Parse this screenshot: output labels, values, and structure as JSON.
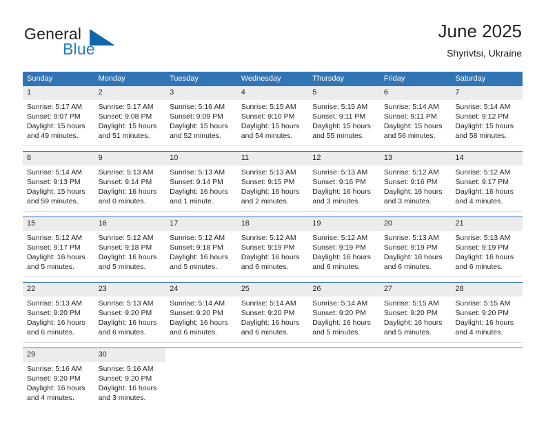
{
  "brand": {
    "name_part1": "General",
    "name_part2": "Blue",
    "logo_icon": "blue-triangle-flag-icon"
  },
  "header": {
    "title": "June 2025",
    "location": "Shyrivtsi, Ukraine"
  },
  "colors": {
    "header_blue": "#3275b5",
    "brand_blue": "#1f7fc4",
    "daynum_gray": "#ececec",
    "text": "#231f20",
    "separator": "#d9d9d9"
  },
  "weekday_headers": [
    "Sunday",
    "Monday",
    "Tuesday",
    "Wednesday",
    "Thursday",
    "Friday",
    "Saturday"
  ],
  "weeks": [
    {
      "days": [
        {
          "date": "1",
          "sunrise": "Sunrise: 5:17 AM",
          "sunset": "Sunset: 9:07 PM",
          "daylight_line1": "Daylight: 15 hours",
          "daylight_line2": "and 49 minutes."
        },
        {
          "date": "2",
          "sunrise": "Sunrise: 5:17 AM",
          "sunset": "Sunset: 9:08 PM",
          "daylight_line1": "Daylight: 15 hours",
          "daylight_line2": "and 51 minutes."
        },
        {
          "date": "3",
          "sunrise": "Sunrise: 5:16 AM",
          "sunset": "Sunset: 9:09 PM",
          "daylight_line1": "Daylight: 15 hours",
          "daylight_line2": "and 52 minutes."
        },
        {
          "date": "4",
          "sunrise": "Sunrise: 5:15 AM",
          "sunset": "Sunset: 9:10 PM",
          "daylight_line1": "Daylight: 15 hours",
          "daylight_line2": "and 54 minutes."
        },
        {
          "date": "5",
          "sunrise": "Sunrise: 5:15 AM",
          "sunset": "Sunset: 9:11 PM",
          "daylight_line1": "Daylight: 15 hours",
          "daylight_line2": "and 55 minutes."
        },
        {
          "date": "6",
          "sunrise": "Sunrise: 5:14 AM",
          "sunset": "Sunset: 9:11 PM",
          "daylight_line1": "Daylight: 15 hours",
          "daylight_line2": "and 56 minutes."
        },
        {
          "date": "7",
          "sunrise": "Sunrise: 5:14 AM",
          "sunset": "Sunset: 9:12 PM",
          "daylight_line1": "Daylight: 15 hours",
          "daylight_line2": "and 58 minutes."
        }
      ]
    },
    {
      "days": [
        {
          "date": "8",
          "sunrise": "Sunrise: 5:14 AM",
          "sunset": "Sunset: 9:13 PM",
          "daylight_line1": "Daylight: 15 hours",
          "daylight_line2": "and 59 minutes."
        },
        {
          "date": "9",
          "sunrise": "Sunrise: 5:13 AM",
          "sunset": "Sunset: 9:14 PM",
          "daylight_line1": "Daylight: 16 hours",
          "daylight_line2": "and 0 minutes."
        },
        {
          "date": "10",
          "sunrise": "Sunrise: 5:13 AM",
          "sunset": "Sunset: 9:14 PM",
          "daylight_line1": "Daylight: 16 hours",
          "daylight_line2": "and 1 minute."
        },
        {
          "date": "11",
          "sunrise": "Sunrise: 5:13 AM",
          "sunset": "Sunset: 9:15 PM",
          "daylight_line1": "Daylight: 16 hours",
          "daylight_line2": "and 2 minutes."
        },
        {
          "date": "12",
          "sunrise": "Sunrise: 5:13 AM",
          "sunset": "Sunset: 9:16 PM",
          "daylight_line1": "Daylight: 16 hours",
          "daylight_line2": "and 3 minutes."
        },
        {
          "date": "13",
          "sunrise": "Sunrise: 5:12 AM",
          "sunset": "Sunset: 9:16 PM",
          "daylight_line1": "Daylight: 16 hours",
          "daylight_line2": "and 3 minutes."
        },
        {
          "date": "14",
          "sunrise": "Sunrise: 5:12 AM",
          "sunset": "Sunset: 9:17 PM",
          "daylight_line1": "Daylight: 16 hours",
          "daylight_line2": "and 4 minutes."
        }
      ]
    },
    {
      "days": [
        {
          "date": "15",
          "sunrise": "Sunrise: 5:12 AM",
          "sunset": "Sunset: 9:17 PM",
          "daylight_line1": "Daylight: 16 hours",
          "daylight_line2": "and 5 minutes."
        },
        {
          "date": "16",
          "sunrise": "Sunrise: 5:12 AM",
          "sunset": "Sunset: 9:18 PM",
          "daylight_line1": "Daylight: 16 hours",
          "daylight_line2": "and 5 minutes."
        },
        {
          "date": "17",
          "sunrise": "Sunrise: 5:12 AM",
          "sunset": "Sunset: 9:18 PM",
          "daylight_line1": "Daylight: 16 hours",
          "daylight_line2": "and 5 minutes."
        },
        {
          "date": "18",
          "sunrise": "Sunrise: 5:12 AM",
          "sunset": "Sunset: 9:19 PM",
          "daylight_line1": "Daylight: 16 hours",
          "daylight_line2": "and 6 minutes."
        },
        {
          "date": "19",
          "sunrise": "Sunrise: 5:12 AM",
          "sunset": "Sunset: 9:19 PM",
          "daylight_line1": "Daylight: 16 hours",
          "daylight_line2": "and 6 minutes."
        },
        {
          "date": "20",
          "sunrise": "Sunrise: 5:13 AM",
          "sunset": "Sunset: 9:19 PM",
          "daylight_line1": "Daylight: 16 hours",
          "daylight_line2": "and 6 minutes."
        },
        {
          "date": "21",
          "sunrise": "Sunrise: 5:13 AM",
          "sunset": "Sunset: 9:19 PM",
          "daylight_line1": "Daylight: 16 hours",
          "daylight_line2": "and 6 minutes."
        }
      ]
    },
    {
      "days": [
        {
          "date": "22",
          "sunrise": "Sunrise: 5:13 AM",
          "sunset": "Sunset: 9:20 PM",
          "daylight_line1": "Daylight: 16 hours",
          "daylight_line2": "and 6 minutes."
        },
        {
          "date": "23",
          "sunrise": "Sunrise: 5:13 AM",
          "sunset": "Sunset: 9:20 PM",
          "daylight_line1": "Daylight: 16 hours",
          "daylight_line2": "and 6 minutes."
        },
        {
          "date": "24",
          "sunrise": "Sunrise: 5:14 AM",
          "sunset": "Sunset: 9:20 PM",
          "daylight_line1": "Daylight: 16 hours",
          "daylight_line2": "and 6 minutes."
        },
        {
          "date": "25",
          "sunrise": "Sunrise: 5:14 AM",
          "sunset": "Sunset: 9:20 PM",
          "daylight_line1": "Daylight: 16 hours",
          "daylight_line2": "and 6 minutes."
        },
        {
          "date": "26",
          "sunrise": "Sunrise: 5:14 AM",
          "sunset": "Sunset: 9:20 PM",
          "daylight_line1": "Daylight: 16 hours",
          "daylight_line2": "and 5 minutes."
        },
        {
          "date": "27",
          "sunrise": "Sunrise: 5:15 AM",
          "sunset": "Sunset: 9:20 PM",
          "daylight_line1": "Daylight: 16 hours",
          "daylight_line2": "and 5 minutes."
        },
        {
          "date": "28",
          "sunrise": "Sunrise: 5:15 AM",
          "sunset": "Sunset: 9:20 PM",
          "daylight_line1": "Daylight: 16 hours",
          "daylight_line2": "and 4 minutes."
        }
      ]
    },
    {
      "days": [
        {
          "date": "29",
          "sunrise": "Sunrise: 5:16 AM",
          "sunset": "Sunset: 9:20 PM",
          "daylight_line1": "Daylight: 16 hours",
          "daylight_line2": "and 4 minutes."
        },
        {
          "date": "30",
          "sunrise": "Sunrise: 5:16 AM",
          "sunset": "Sunset: 9:20 PM",
          "daylight_line1": "Daylight: 16 hours",
          "daylight_line2": "and 3 minutes."
        },
        {
          "date": "",
          "sunrise": "",
          "sunset": "",
          "daylight_line1": "",
          "daylight_line2": ""
        },
        {
          "date": "",
          "sunrise": "",
          "sunset": "",
          "daylight_line1": "",
          "daylight_line2": ""
        },
        {
          "date": "",
          "sunrise": "",
          "sunset": "",
          "daylight_line1": "",
          "daylight_line2": ""
        },
        {
          "date": "",
          "sunrise": "",
          "sunset": "",
          "daylight_line1": "",
          "daylight_line2": ""
        },
        {
          "date": "",
          "sunrise": "",
          "sunset": "",
          "daylight_line1": "",
          "daylight_line2": ""
        }
      ]
    }
  ]
}
